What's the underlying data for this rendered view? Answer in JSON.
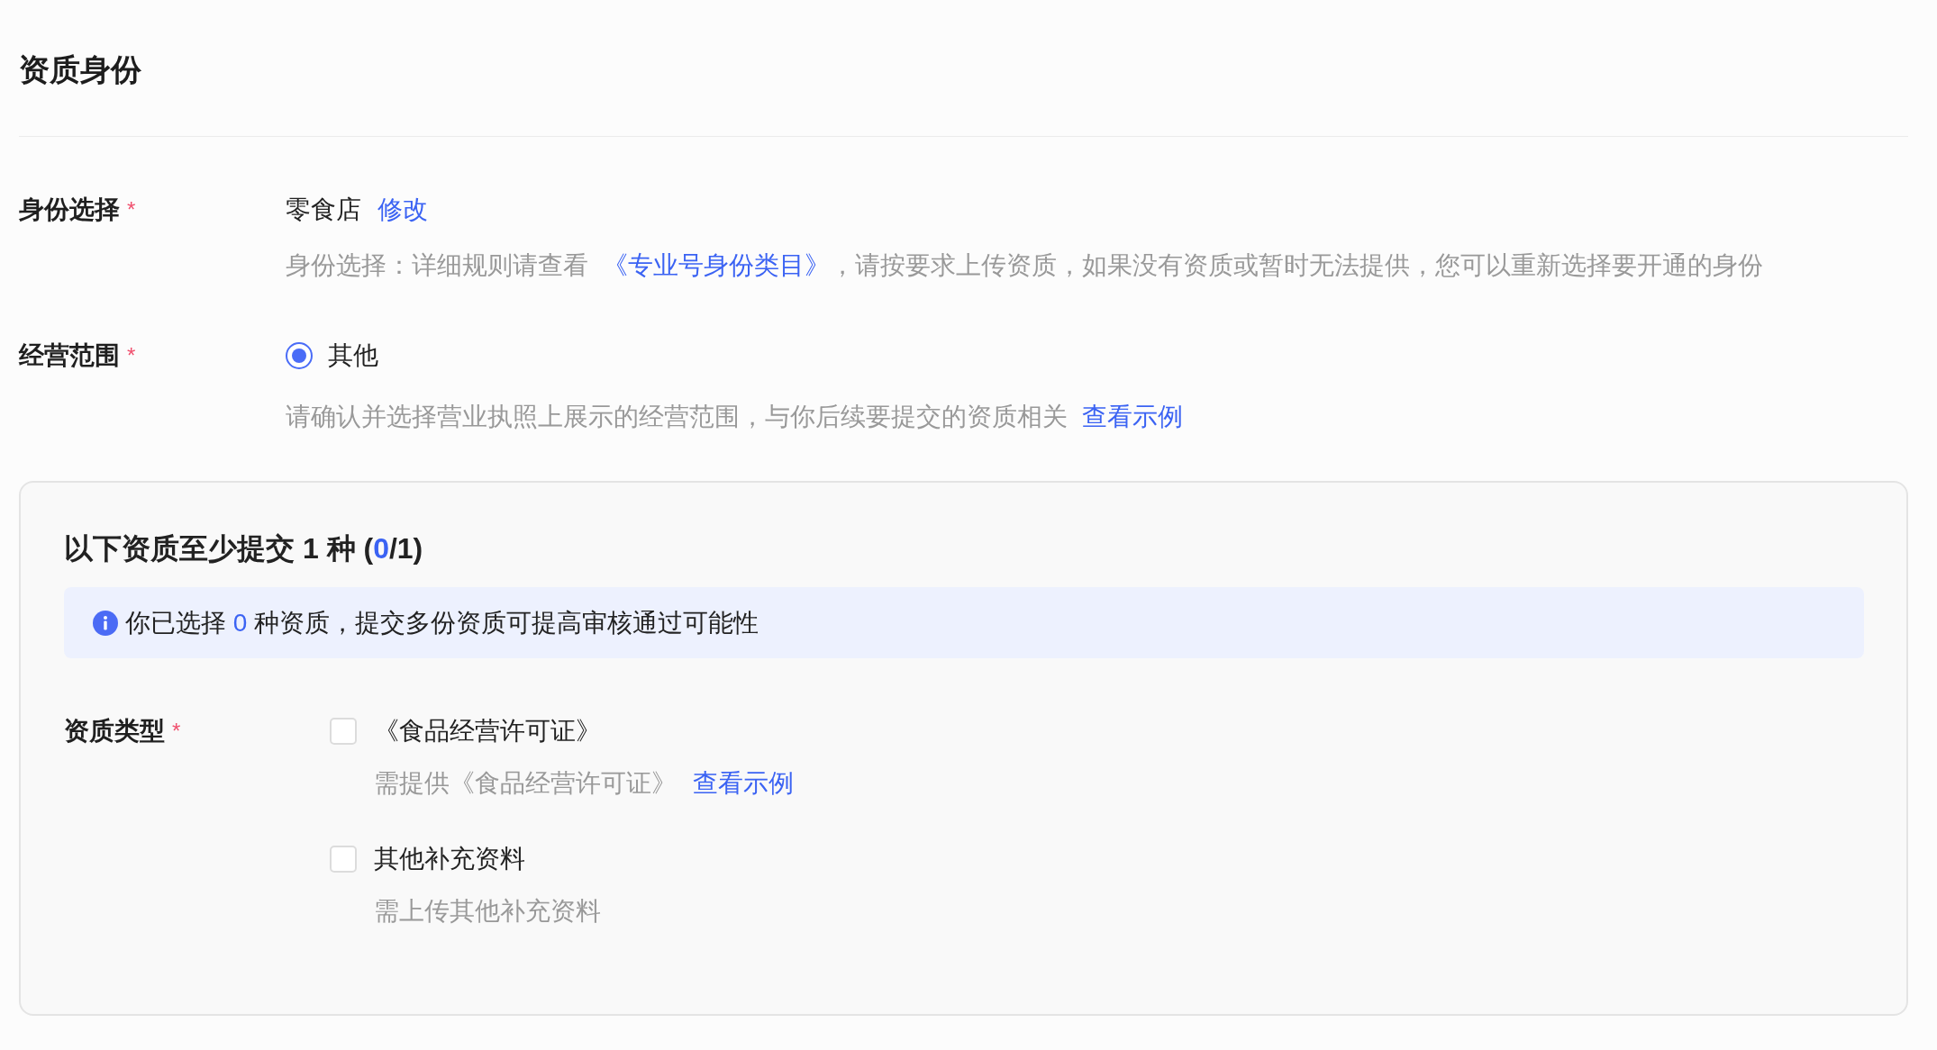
{
  "page_title": "资质身份",
  "fields": [
    {
      "kind": "value",
      "label": "身份选择",
      "required_mark": "*",
      "value": "零食店",
      "action": "修改",
      "hint": {
        "before": "身份选择：详细规则请查看",
        "link": "《专业号身份类目》",
        "after": "，请按要求上传资质，如果没有资质或暂时无法提供，您可以重新选择要开通的身份"
      }
    },
    {
      "kind": "radio",
      "label": "经营范围",
      "required_mark": "*",
      "options": [
        {
          "label": "其他",
          "selected": true
        }
      ],
      "hint": {
        "before": "请确认并选择营业执照上展示的经营范围，与你后续要提交的资质相关",
        "link": "查看示例"
      }
    }
  ],
  "qualification_card": {
    "title": [
      {
        "text": "以下资质至少提交 1 种 (",
        "highlight": false
      },
      {
        "text": "0",
        "highlight": true
      },
      {
        "text": "/1)",
        "highlight": false
      }
    ],
    "notice": [
      {
        "text": "你已选择 ",
        "highlight": false
      },
      {
        "text": "0",
        "highlight": true
      },
      {
        "text": " 种资质，提交多份资质可提高审核通过可能性",
        "highlight": false
      }
    ],
    "field": {
      "label": "资质类型",
      "required_mark": "*",
      "options": [
        {
          "label": "《食品经营许可证》",
          "checked": false,
          "description": "需提供《食品经营许可证》",
          "link": "查看示例"
        },
        {
          "label": "其他补充资料",
          "checked": false,
          "description": "需上传其他补充资料"
        }
      ]
    }
  }
}
